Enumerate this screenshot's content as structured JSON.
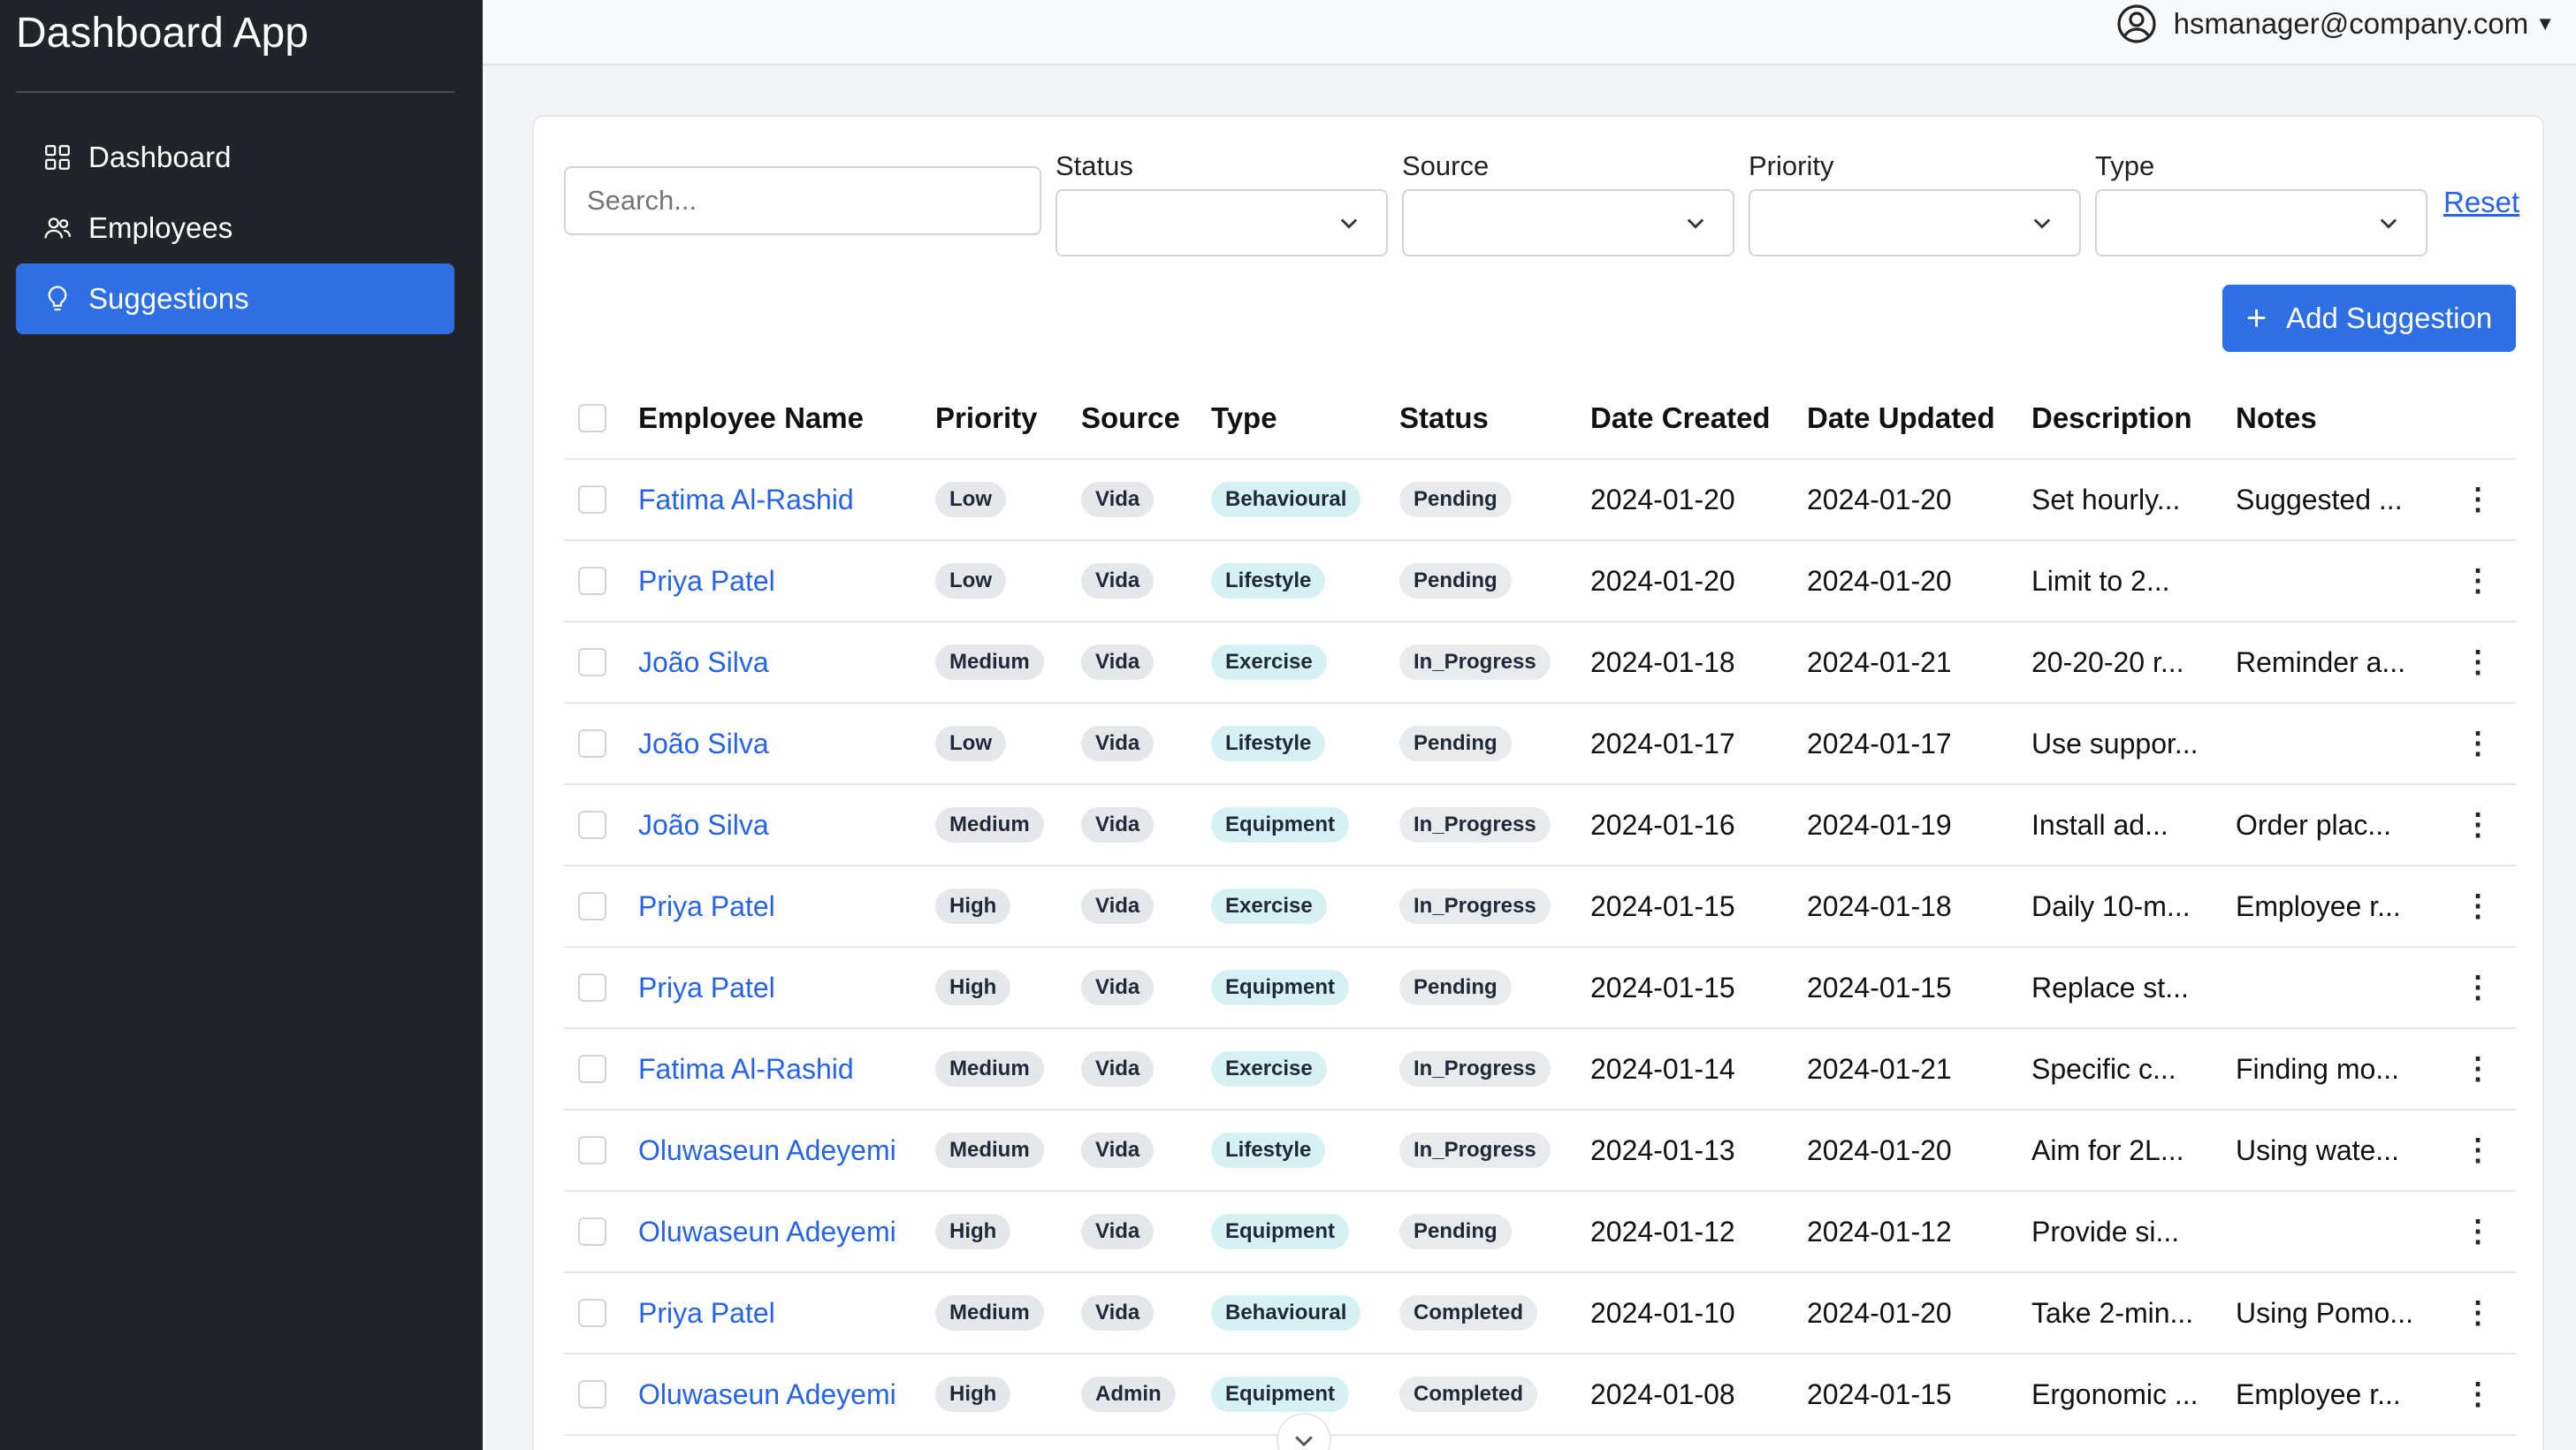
{
  "app": {
    "title": "Dashboard App"
  },
  "sidebar": {
    "items": [
      {
        "label": "Dashboard",
        "icon": "grid-icon",
        "active": false
      },
      {
        "label": "Employees",
        "icon": "users-icon",
        "active": false
      },
      {
        "label": "Suggestions",
        "icon": "lightbulb-icon",
        "active": true
      }
    ]
  },
  "topbar": {
    "user_email": "hsmanager@company.com"
  },
  "filters": {
    "search_placeholder": "Search...",
    "status_label": "Status",
    "source_label": "Source",
    "priority_label": "Priority",
    "type_label": "Type",
    "reset_label": "Reset"
  },
  "toolbar": {
    "add_label": "Add Suggestion"
  },
  "table": {
    "headers": {
      "employee": "Employee Name",
      "priority": "Priority",
      "source": "Source",
      "type": "Type",
      "status": "Status",
      "created": "Date Created",
      "updated": "Date Updated",
      "description": "Description",
      "notes": "Notes"
    },
    "rows": [
      {
        "employee": "Fatima Al-Rashid",
        "priority": "Low",
        "source": "Vida",
        "type": "Behavioural",
        "status": "Pending",
        "created": "2024-01-20",
        "updated": "2024-01-20",
        "description": "Set hourly...",
        "notes": "Suggested ..."
      },
      {
        "employee": "Priya Patel",
        "priority": "Low",
        "source": "Vida",
        "type": "Lifestyle",
        "status": "Pending",
        "created": "2024-01-20",
        "updated": "2024-01-20",
        "description": "Limit to 2...",
        "notes": ""
      },
      {
        "employee": "João Silva",
        "priority": "Medium",
        "source": "Vida",
        "type": "Exercise",
        "status": "In_Progress",
        "created": "2024-01-18",
        "updated": "2024-01-21",
        "description": "20-20-20 r...",
        "notes": "Reminder a..."
      },
      {
        "employee": "João Silva",
        "priority": "Low",
        "source": "Vida",
        "type": "Lifestyle",
        "status": "Pending",
        "created": "2024-01-17",
        "updated": "2024-01-17",
        "description": "Use suppor...",
        "notes": ""
      },
      {
        "employee": "João Silva",
        "priority": "Medium",
        "source": "Vida",
        "type": "Equipment",
        "status": "In_Progress",
        "created": "2024-01-16",
        "updated": "2024-01-19",
        "description": "Install ad...",
        "notes": "Order plac..."
      },
      {
        "employee": "Priya Patel",
        "priority": "High",
        "source": "Vida",
        "type": "Exercise",
        "status": "In_Progress",
        "created": "2024-01-15",
        "updated": "2024-01-18",
        "description": "Daily 10-m...",
        "notes": "Employee r..."
      },
      {
        "employee": "Priya Patel",
        "priority": "High",
        "source": "Vida",
        "type": "Equipment",
        "status": "Pending",
        "created": "2024-01-15",
        "updated": "2024-01-15",
        "description": "Replace st...",
        "notes": ""
      },
      {
        "employee": "Fatima Al-Rashid",
        "priority": "Medium",
        "source": "Vida",
        "type": "Exercise",
        "status": "In_Progress",
        "created": "2024-01-14",
        "updated": "2024-01-21",
        "description": "Specific c...",
        "notes": "Finding mo..."
      },
      {
        "employee": "Oluwaseun Adeyemi",
        "priority": "Medium",
        "source": "Vida",
        "type": "Lifestyle",
        "status": "In_Progress",
        "created": "2024-01-13",
        "updated": "2024-01-20",
        "description": "Aim for 2L...",
        "notes": "Using wate..."
      },
      {
        "employee": "Oluwaseun Adeyemi",
        "priority": "High",
        "source": "Vida",
        "type": "Equipment",
        "status": "Pending",
        "created": "2024-01-12",
        "updated": "2024-01-12",
        "description": "Provide si...",
        "notes": ""
      },
      {
        "employee": "Priya Patel",
        "priority": "Medium",
        "source": "Vida",
        "type": "Behavioural",
        "status": "Completed",
        "created": "2024-01-10",
        "updated": "2024-01-20",
        "description": "Take 2-min...",
        "notes": "Using Pomo..."
      },
      {
        "employee": "Oluwaseun Adeyemi",
        "priority": "High",
        "source": "Admin",
        "type": "Equipment",
        "status": "Completed",
        "created": "2024-01-08",
        "updated": "2024-01-15",
        "description": "Ergonomic ...",
        "notes": "Employee r..."
      }
    ]
  },
  "colors": {
    "sidebar_bg": "#212529",
    "accent": "#2f6fe4",
    "link": "#2563eb",
    "badge_neutral": "#e5e7eb",
    "badge_type": "#d6f1f4",
    "badge_status": "#e9eaec"
  }
}
